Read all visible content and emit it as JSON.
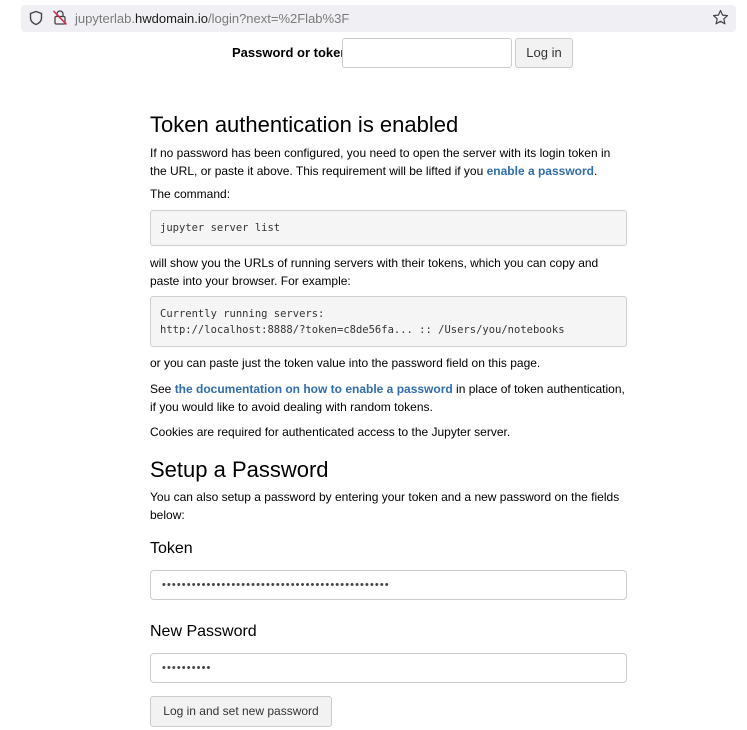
{
  "browser": {
    "url_host_prefix": "jupyterlab.",
    "url_host": "hwdomain.io",
    "url_path": "/login?next=%2Flab%3F"
  },
  "login": {
    "password_label": "Password or token:",
    "password_value": "",
    "login_button": "Log in"
  },
  "token_section": {
    "heading": "Token authentication is enabled",
    "intro_text": "If no password has been configured, you need to open the server with its login token in the URL, or paste it above. This requirement will be lifted if you ",
    "intro_link": "enable a password",
    "intro_end": ".",
    "command_label": "The command:",
    "command_code": "jupyter server list",
    "show_text": "will show you the URLs of running servers with their tokens, which you can copy and paste into your browser. For example:",
    "example_line1": "Currently running servers:",
    "example_line2": "http://localhost:8888/?token=c8de56fa... :: /Users/you/notebooks",
    "paste_text": "or you can paste just the token value into the password field on this page.",
    "see_prefix": "See ",
    "see_link": "the documentation on how to enable a password",
    "see_suffix": " in place of token authentication, if you would like to avoid dealing with random tokens.",
    "cookies_text": "Cookies are required for authenticated access to the Jupyter server."
  },
  "setup_section": {
    "heading": "Setup a Password",
    "intro_text": "You can also setup a password by entering your token and a new password on the fields below:",
    "token_label": "Token",
    "token_value": "••••••••••••••••••••••••••••••••••••••••••••••",
    "new_password_label": "New Password",
    "new_password_value": "••••••••••",
    "submit_button": "Log in and set new password"
  }
}
